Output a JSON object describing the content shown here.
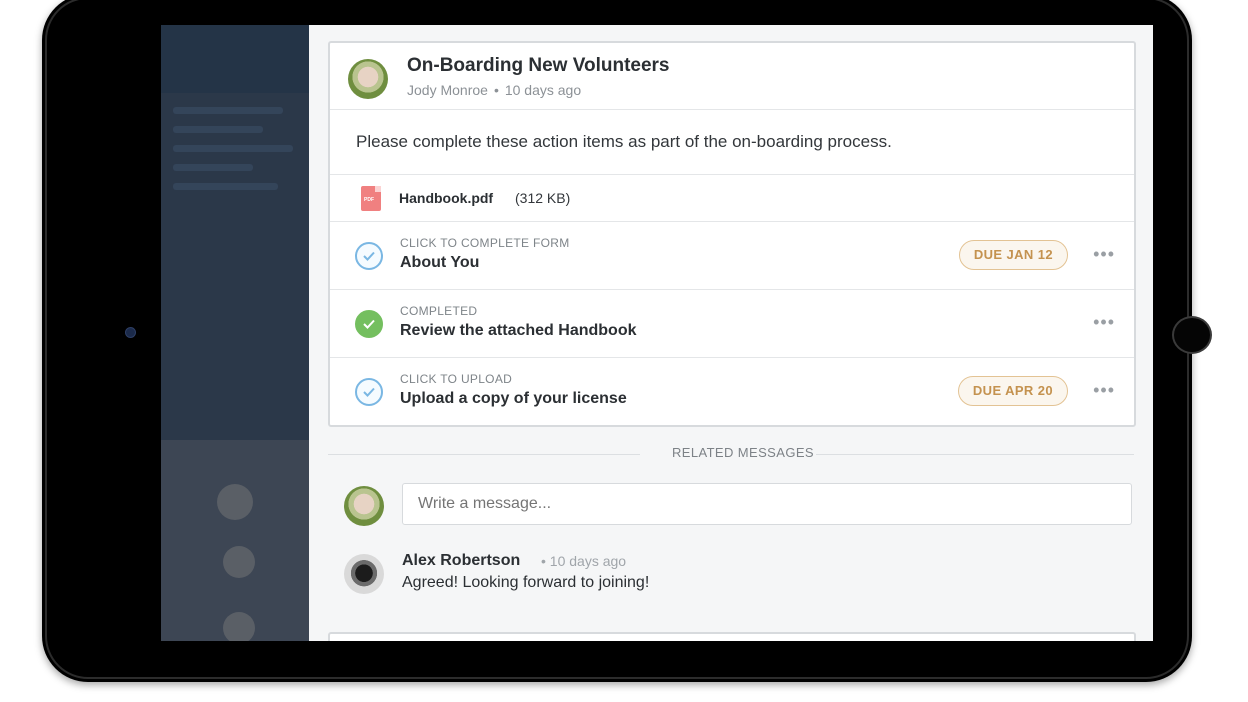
{
  "post": {
    "title": "On-Boarding New Volunteers",
    "author": "Jody Monroe",
    "time": "10 days ago",
    "body": "Please complete these action items as part of the on-boarding process.",
    "attachment": {
      "name": "Handbook.pdf",
      "size": "(312 KB)",
      "icon": "pdf-icon"
    },
    "actions": [
      {
        "label": "CLICK TO COMPLETE FORM",
        "title": "About You",
        "due": "DUE JAN 12",
        "completed": false
      },
      {
        "label": "COMPLETED",
        "title": "Review the attached Handbook",
        "due": "",
        "completed": true
      },
      {
        "label": "CLICK TO UPLOAD",
        "title": "Upload a copy of your license",
        "due": "DUE APR 20",
        "completed": false
      }
    ]
  },
  "related": {
    "label": "RELATED MESSAGES",
    "input_placeholder": "Write a message...",
    "messages": [
      {
        "author": "Alex Robertson",
        "time": "10 days ago",
        "text": "Agreed! Looking forward to joining!"
      }
    ]
  },
  "colors": {
    "due_badge_text": "#c4924f",
    "completed_green": "#74bf5f",
    "pending_blue": "#7ab7e3",
    "background_app": "#2b3849"
  }
}
